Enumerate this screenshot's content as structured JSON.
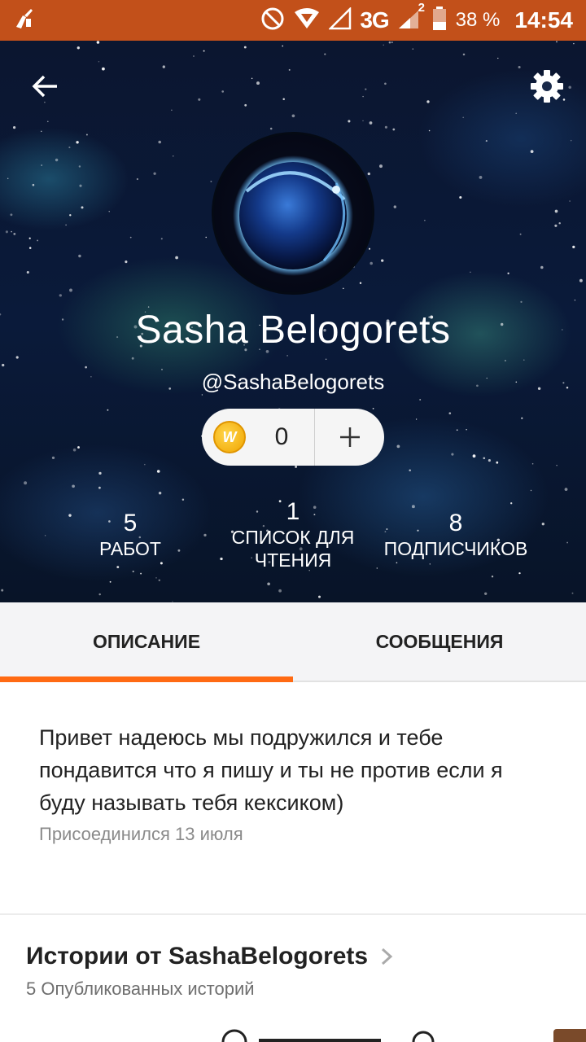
{
  "status_bar": {
    "battery": "38 %",
    "network": "3G",
    "sim_slot": "2",
    "time": "14:54",
    "icons": [
      "cleaner-icon",
      "block-icon",
      "wifi-icon",
      "signal-icon",
      "signal-icon",
      "battery-icon"
    ]
  },
  "profile": {
    "name": "Sasha Belogorets",
    "handle": "@SashaBelogorets",
    "coins": "0",
    "coin_icon_letter": "W"
  },
  "stats": [
    {
      "value": "5",
      "label": "РАБОТ"
    },
    {
      "value": "1",
      "label": "СПИСОК ДЛЯ ЧТЕНИЯ"
    },
    {
      "value": "8",
      "label": "ПОДПИСЧИКОВ"
    }
  ],
  "tabs": [
    {
      "label": "ОПИСАНИЕ",
      "active": true
    },
    {
      "label": "СООБЩЕНИЯ",
      "active": false
    }
  ],
  "about": {
    "text": "Привет надеюсь мы подружился и тебе пондавится что я пишу и ты не против если я буду называть тебя кексиком)",
    "joined": "Присоединился 13 июля"
  },
  "stories": {
    "title": "Истории от SashaBelogorets",
    "subtitle": "5 Опубликованных историй"
  },
  "colors": {
    "status_bar": "#c2501a",
    "accent": "#ff6a13",
    "tab_bg": "#f4f4f6"
  }
}
